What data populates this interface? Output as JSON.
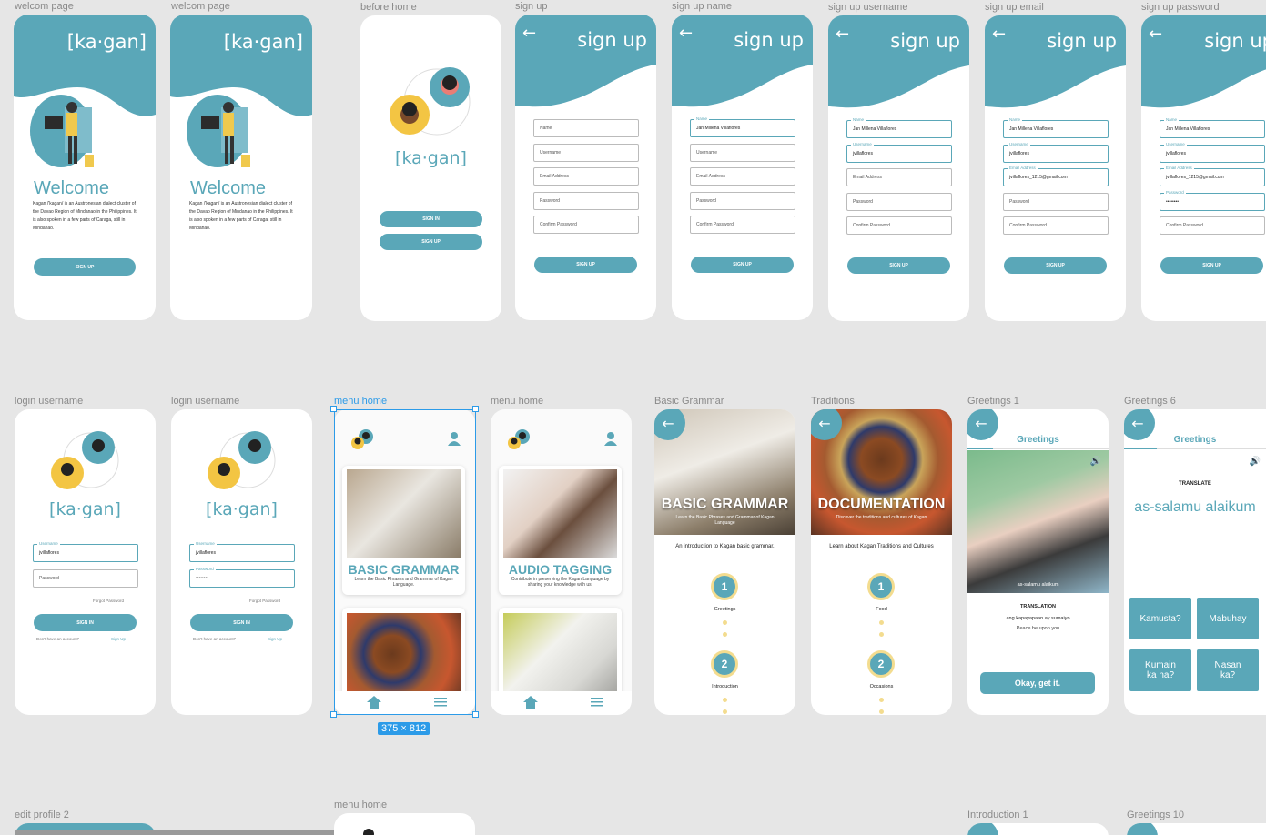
{
  "labels": {
    "f1": "welcom page",
    "f2": "welcom page",
    "f3": "before home",
    "f4": "sign up",
    "f5": "sign up name",
    "f6": "sign up username",
    "f7": "sign up email",
    "f8": "sign up password",
    "r2_1": "login username",
    "r2_2": "login username",
    "r2_3": "menu home",
    "r2_4": "menu home",
    "r2_5": "Basic Grammar",
    "r2_6": "Traditions",
    "r2_7": "Greetings 1",
    "r2_8": "Greetings 6",
    "r3_1": "edit profile 2",
    "r3_2": "menu home",
    "r3_3": "Introduction 1",
    "r3_4": "Greetings 10"
  },
  "brand": "[ka·gan]",
  "welcome": {
    "title": "Welcome",
    "text": "Kagan /'kagan/ is an Austronesian dialect cluster of the Davao Region of Mindanao in the Philippines. It is also spoken in a few parts of Caraga, still in Mindanao.",
    "button": "SIGN UP"
  },
  "before_home": {
    "sign_in": "SIGN IN",
    "sign_up": "SIGN UP"
  },
  "signup": {
    "header": "sign up",
    "back": "←",
    "placeholders": {
      "name": "Name",
      "username": "Username",
      "email": "Email Address",
      "password": "Password",
      "confirm": "Confirm Password"
    },
    "values": {
      "name": "Jan Millena Villaflores",
      "username": "jvillaflores",
      "email": "jvillaflores_1215@gmail.com",
      "password": "••••••••"
    },
    "button": "SIGN UP"
  },
  "login": {
    "username_label": "Username",
    "username_value": "jvillaflores",
    "password_placeholder": "Password",
    "password_label": "Password",
    "password_value": "••••••••",
    "forgot": "Forgot Password",
    "button": "SIGN IN",
    "no_account": "Don't have an account?",
    "sign_up_link": "Sign Up"
  },
  "menu": {
    "card1_title": "BASIC GRAMMAR",
    "card1_sub": "Learn the Basic Phrases and Grammar of Kagan Language.",
    "card2_title": "AUDIO TAGGING",
    "card2_sub": "Contribute in preserving the Kagan Language by sharing your knowledge with us.",
    "dimension": "375 × 812"
  },
  "basic_grammar": {
    "title": "BASIC GRAMMAR",
    "sub": "Learn the Basic Phrases and Grammar of Kagan Language",
    "intro": "An introduction to Kagan basic grammar.",
    "steps": [
      {
        "n": "1",
        "label": "Greetings"
      },
      {
        "n": "2",
        "label": "Introduction"
      }
    ]
  },
  "traditions": {
    "title": "DOCUMENTATION",
    "sub": "Discover the traditions and cultures of Kagan",
    "intro": "Learn about Kagan Traditions and Cultures",
    "steps": [
      {
        "n": "1",
        "label": "Food"
      },
      {
        "n": "2",
        "label": "Occasions"
      }
    ]
  },
  "greetings1": {
    "tab": "Greetings",
    "caption": "as-salamu alaikum",
    "translation_label": "TRANSLATION",
    "translation": "ang kapayapaan ay sumaiyo",
    "english": "Peace be upon you",
    "button": "Okay, get it."
  },
  "greetings6": {
    "tab": "Greetings",
    "translate_label": "TRANSLATE",
    "phrase": "as-salamu alaikum",
    "options": [
      "Kamusta?",
      "Mabuhay",
      "Kumain ka na?",
      "Nasan ka?"
    ]
  },
  "colors": {
    "teal": "#5aa7b8",
    "yellow": "#f3dc8f",
    "selection": "#2c9be8"
  }
}
